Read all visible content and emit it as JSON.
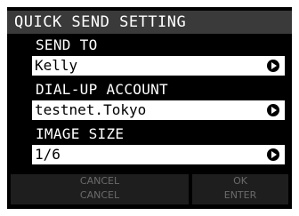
{
  "title": "QUICK SEND SETTING",
  "fields": [
    {
      "label": "SEND TO",
      "value": "Kelly"
    },
    {
      "label": "DIAL-UP ACCOUNT",
      "value": "testnet.Tokyo"
    },
    {
      "label": "IMAGE SIZE",
      "value": "1/6"
    }
  ],
  "buttons": {
    "cancel": {
      "label": "CANCEL",
      "key": "CANCEL"
    },
    "ok": {
      "label": "OK",
      "key": "ENTER"
    }
  }
}
